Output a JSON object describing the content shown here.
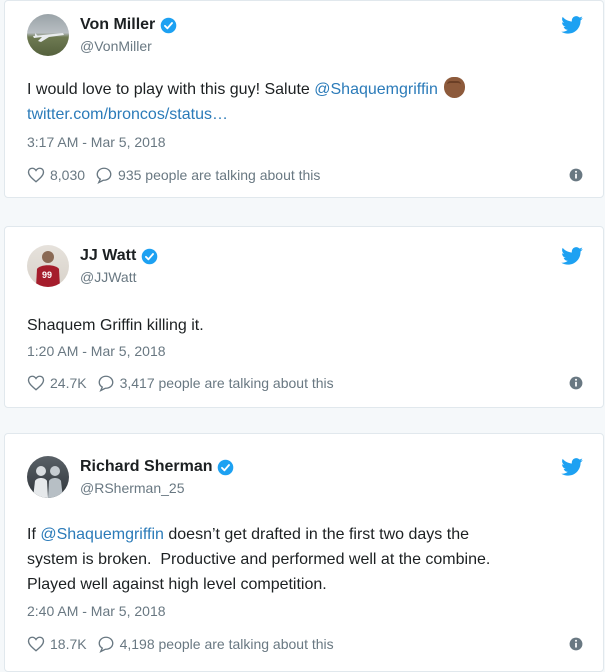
{
  "tweets": [
    {
      "name": "Von Miller",
      "handle": "@VonMiller",
      "text_before": "I would love to play with this guy! Salute ",
      "mention": "@Shaquemgriffin",
      "text_after": "",
      "link": "twitter.com/broncos/status…",
      "emoji_icon": "raised-fist-medium-dark-skin",
      "time": "3:17 AM - Mar 5, 2018",
      "likes": "8,030",
      "talking": "935 people are talking about this"
    },
    {
      "name": "JJ Watt",
      "handle": "@JJWatt",
      "text": "Shaquem Griffin killing it.",
      "time": "1:20 AM - Mar 5, 2018",
      "likes": "24.7K",
      "talking": "3,417 people are talking about this"
    },
    {
      "name": "Richard Sherman",
      "handle": "@RSherman_25",
      "text_prefix": "If ",
      "mention": "@Shaquemgriffin",
      "text_line1_rest": " doesn’t get drafted in the first two days the",
      "text_line2": "system is broken.  Productive and performed well at the combine.",
      "text_line3": "Played well against high level competition.",
      "time": "2:40 AM - Mar 5, 2018",
      "likes": "18.7K",
      "talking": "4,198 people are talking about this"
    }
  ],
  "colors": {
    "twitter_blue": "#1da1f2",
    "link_blue": "#2b7bb9",
    "meta_gray": "#697882"
  },
  "icons": [
    "verified-badge-icon",
    "twitter-bird-icon",
    "heart-icon",
    "reply-bubble-icon",
    "info-icon"
  ]
}
